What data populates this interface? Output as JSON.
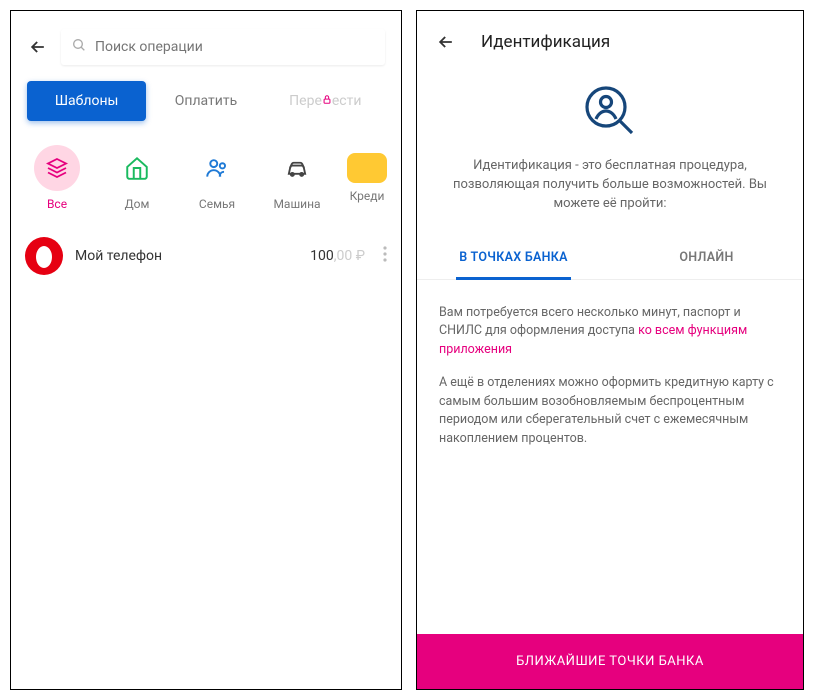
{
  "left": {
    "search_placeholder": "Поиск операции",
    "tabs": {
      "templates": "Шаблоны",
      "pay": "Оплатить",
      "transfer_prefix": "Пере",
      "transfer_suffix": "ести"
    },
    "categories": [
      {
        "label": "Все"
      },
      {
        "label": "Дом"
      },
      {
        "label": "Семья"
      },
      {
        "label": "Машина"
      },
      {
        "label": "Креди"
      }
    ],
    "list": {
      "phone_title": "Мой телефон",
      "phone_amount_main": "100",
      "phone_amount_dec": ",00 ₽"
    }
  },
  "right": {
    "title": "Идентификация",
    "description": "Идентификация - это бесплатная процедура, позволяющая получить больше возможностей. Вы можете её пройти:",
    "tabs": {
      "bank_points": "В ТОЧКАХ БАНКА",
      "online": "ОНЛАЙН"
    },
    "para1_a": "Вам потребуется всего несколько минут, паспорт и СНИЛС для оформления доступа ",
    "para1_b": "ко всем функциям приложения",
    "para2": "А ещё в отделениях можно оформить кредитную карту с самым большим возобновляемым беспроцентным периодом или сберегательный счет с ежемесячным накоплением процентов.",
    "cta": "БЛИЖАЙШИЕ ТОЧКИ БАНКА"
  }
}
